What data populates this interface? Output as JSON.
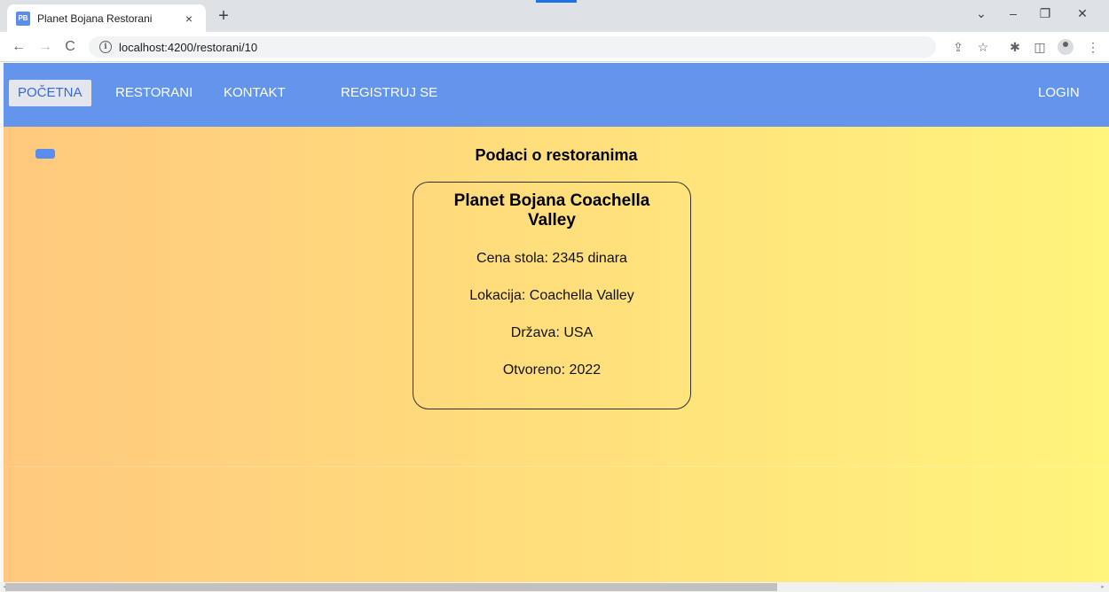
{
  "browser": {
    "tab_title": "Planet Bojana Restorani",
    "favicon_text": "PB",
    "tab_close": "×",
    "new_tab": "+",
    "back": "←",
    "forward": "→",
    "reload": "C",
    "info": "i",
    "url": "localhost:4200/restorani/10",
    "controls": {
      "chevron": "⌄",
      "minimize": "–",
      "restore": "❐",
      "close": "✕"
    },
    "toolbar": {
      "share": "⇪",
      "star": "☆",
      "extensions": "✱",
      "sidepanel": "◫",
      "menu": "⋮"
    }
  },
  "nav": {
    "items": [
      {
        "label": "POČETNA",
        "active": true
      },
      {
        "label": "RESTORANI"
      },
      {
        "label": "KONTAKT"
      },
      {
        "label": "REGISTRUJ SE"
      }
    ],
    "login": "LOGIN"
  },
  "main": {
    "heading": "Podaci o restoranima",
    "card": {
      "title": "Planet Bojana Coachella Valley",
      "lines": [
        "Cena stola: 2345 dinara",
        "Lokacija: Coachella Valley",
        "Država: USA",
        "Otvoreno: 2022"
      ]
    }
  },
  "colors": {
    "nav_bg": "#6495ed",
    "gradient_start": "#ffc97d",
    "gradient_end": "#fff47c",
    "toggle_btn": "#5b8def"
  },
  "scrollbar": {
    "left_arrow": "◂",
    "right_arrow": "▸"
  }
}
